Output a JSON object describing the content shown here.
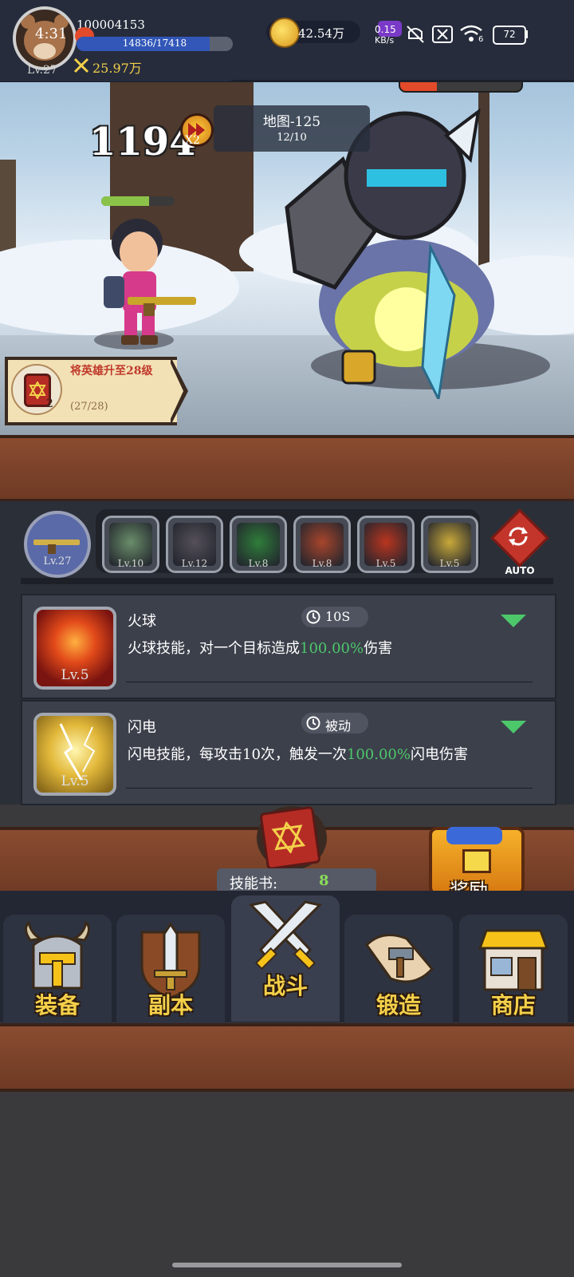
{
  "status_bar": {
    "net_speed": "0.15",
    "net_unit": "KB/s",
    "battery": "72",
    "clock_partial": "4:31",
    "signal_label": "6"
  },
  "player": {
    "id": "100004153",
    "level": "Lv.27",
    "exp_text": "14836/17418",
    "exp_fraction": 0.852,
    "power": "25.97万",
    "gold": "42.54万"
  },
  "battle": {
    "damage": "1194",
    "speed_label": "X2",
    "map_title": "地图-125",
    "map_progress": "12/10",
    "enemy_hp_fraction": 0.3,
    "hero_hp_fraction": 0.65
  },
  "quest": {
    "title": "将英雄升至28级",
    "progress": "(27/28)",
    "count": "2"
  },
  "skill_bar": {
    "weapon_level": "Lv.27",
    "slots": [
      {
        "name": "slot-1",
        "level": "Lv.10",
        "color": "#6a8e6a"
      },
      {
        "name": "slot-2",
        "level": "Lv.12",
        "color": "#55505a"
      },
      {
        "name": "slot-3",
        "level": "Lv.8",
        "color": "#2f7d3a"
      },
      {
        "name": "slot-4",
        "level": "Lv.8",
        "color": "#a8452c"
      },
      {
        "name": "slot-5",
        "level": "Lv.5",
        "color": "#b9351f"
      },
      {
        "name": "slot-6",
        "level": "Lv.5",
        "color": "#c9a93a"
      }
    ],
    "auto_label": "AUTO"
  },
  "skills": [
    {
      "name": "火球",
      "level": "Lv.5",
      "cooldown": "10S",
      "desc_prefix": "火球技能，对一个目标造成",
      "desc_value": "100.00%",
      "desc_suffix": "伤害"
    },
    {
      "name": "闪电",
      "level": "Lv.5",
      "cooldown": "被动",
      "desc_prefix": "闪电技能，每攻击10次，触发一次",
      "desc_value": "100.00%",
      "desc_suffix": "闪电伤害"
    }
  ],
  "skill_books": {
    "label": "技能书:",
    "count": "8"
  },
  "reward_label": "奖励",
  "nav": [
    {
      "key": "equipment",
      "label": "装备"
    },
    {
      "key": "dungeon",
      "label": "副本"
    },
    {
      "key": "battle",
      "label": "战斗"
    },
    {
      "key": "forge",
      "label": "锻造"
    },
    {
      "key": "shop",
      "label": "商店"
    }
  ],
  "colors": {
    "accent_green": "#4cc76a",
    "gold_text": "#f4d04a",
    "panel_bg": "#2b2f38",
    "wood": "#7a4129"
  }
}
